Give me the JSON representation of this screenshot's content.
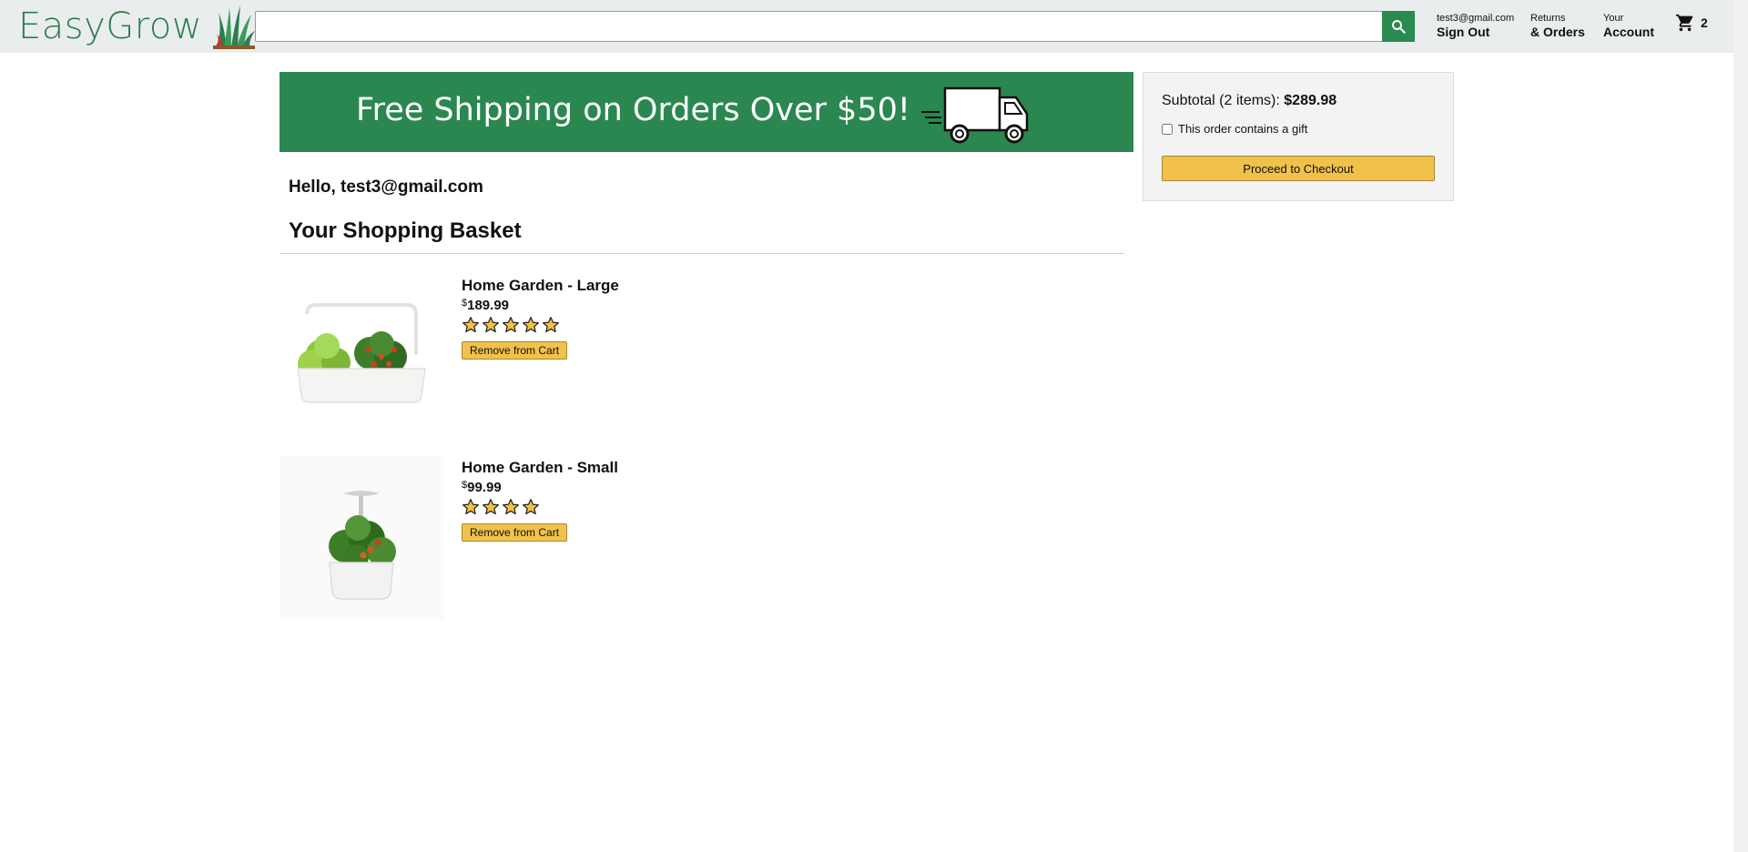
{
  "header": {
    "brand": "EasyGrow",
    "search": {
      "value": "",
      "placeholder": ""
    },
    "account_email": "test3@gmail.com",
    "sign_out_label": "Sign Out",
    "returns_line1": "Returns",
    "returns_line2": "& Orders",
    "account_line1": "Your",
    "account_line2": "Account",
    "cart_count": "2"
  },
  "banner": {
    "text": "Free Shipping on Orders Over $50!"
  },
  "greeting": "Hello, test3@gmail.com",
  "basket_title": "Your Shopping Basket",
  "items": [
    {
      "name": "Home Garden - Large",
      "currency": "$",
      "price": "189.99",
      "rating": 5,
      "remove_label": "Remove from Cart"
    },
    {
      "name": "Home Garden - Small",
      "currency": "$",
      "price": "99.99",
      "rating": 4,
      "remove_label": "Remove from Cart"
    }
  ],
  "subtotal": {
    "label": "Subtotal (2 items):",
    "amount": "$289.98",
    "gift_label": "This order contains a gift",
    "gift_checked": false,
    "checkout_label": "Proceed to Checkout"
  },
  "colors": {
    "brand_green": "#2b8750",
    "button_yellow": "#f0c14b",
    "header_bg": "#eaeded"
  }
}
